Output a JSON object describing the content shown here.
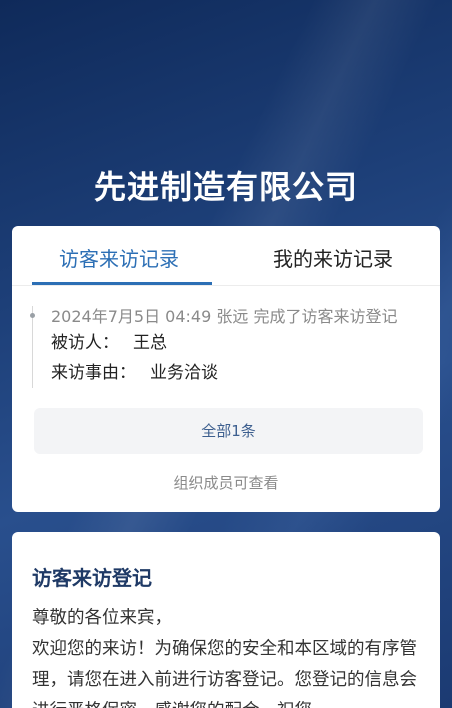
{
  "company": {
    "name": "先进制造有限公司"
  },
  "tabs": [
    {
      "label": "访客来访记录",
      "active": true
    },
    {
      "label": "我的来访记录",
      "active": false
    }
  ],
  "record": {
    "meta": "2024年7月5日 04:49  张远  完成了访客来访登记",
    "host_label": "被访人：",
    "host_value": "王总",
    "reason_label": "来访事由：",
    "reason_value": "业务洽谈"
  },
  "summary": {
    "total_label": "全部1条",
    "note": "组织成员可查看"
  },
  "registration": {
    "title": "访客来访登记",
    "greeting": "尊敬的各位来宾，",
    "body": "欢迎您的来访！为确保您的安全和本区域的有序管理，请您在进入前进行访客登记。您登记的信息会进行严格保密，感谢您的配合，祝您"
  },
  "colors": {
    "accent": "#2c6fb5",
    "header_bg": "#1d3f78",
    "title_dark": "#1f3a66"
  }
}
